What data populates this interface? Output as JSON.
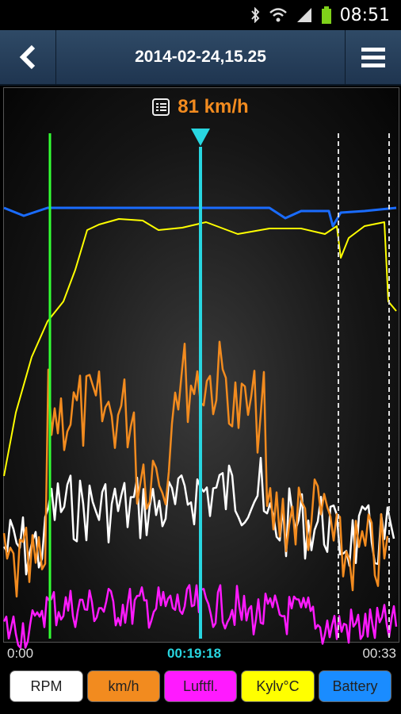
{
  "status_bar": {
    "time": "08:51",
    "icons": [
      "bluetooth-icon",
      "wifi-icon",
      "signal-icon",
      "battery-icon"
    ]
  },
  "header": {
    "title": "2014-02-24,15.25",
    "back_icon": "chevron-left-icon",
    "menu_icon": "hamburger-menu-icon"
  },
  "readout": {
    "icon": "list-icon",
    "value": "81 km/h"
  },
  "time_axis": {
    "start": "0:00",
    "cursor": "00:19:18",
    "end": "00:33"
  },
  "legend": [
    {
      "label": "RPM",
      "color": "#ffffff"
    },
    {
      "label": "km/h",
      "color": "#f28b1f"
    },
    {
      "label": "Luftfl.",
      "color": "#ff1aff"
    },
    {
      "label": "Kylv°C",
      "color": "#ffff00"
    },
    {
      "label": "Battery",
      "color": "#1a8cff"
    }
  ],
  "colors": {
    "cursor": "#28d6e0",
    "marker_green": "#33ff33",
    "rpm": "#ffffff",
    "speed": "#f28b1f",
    "air": "#ff1aff",
    "coolant": "#ffff00",
    "battery": "#1a6cff"
  },
  "chart_data": {
    "type": "line",
    "cursor_time": "00:19:18",
    "cursor_speed_kmh": 81,
    "x_range": [
      "0:00",
      "00:33"
    ],
    "series": [
      {
        "name": "RPM"
      },
      {
        "name": "km/h"
      },
      {
        "name": "Luftfl."
      },
      {
        "name": "Kylv°C"
      },
      {
        "name": "Battery"
      }
    ]
  }
}
